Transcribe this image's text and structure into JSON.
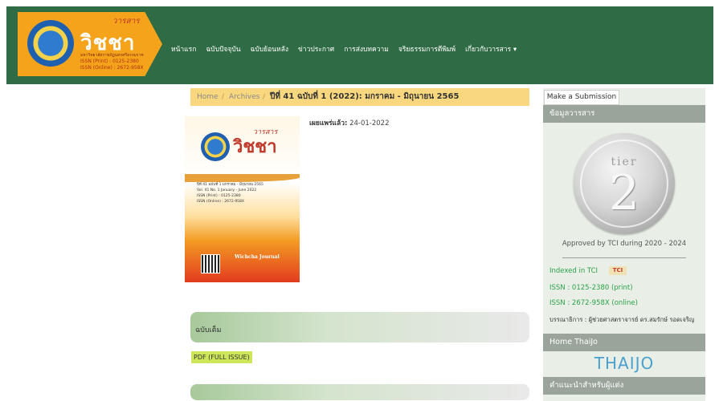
{
  "header": {
    "logo_top": "วารสาร",
    "logo_word": "วิชชา",
    "logo_sub": "มหาวิทยาลัยราชภัฏนครศรีธรรมราช",
    "logo_issn_print": "ISSN (Print) : 0125-2380",
    "logo_issn_online": "ISSN (Online) : 2672-958X",
    "nav": [
      "หน้าแรก",
      "ฉบับปัจจุบัน",
      "ฉบับย้อนหลัง",
      "ข่าวประกาศ",
      "การส่งบทความ",
      "จริยธรรมการตีพิมพ์",
      "เกี่ยวกับวารสาร ▾"
    ]
  },
  "breadcrumb": {
    "home": "Home",
    "sep": "/",
    "archives": "Archives",
    "current": "ปีที่ 41 ฉบับที่ 1 (2022): มกราคม - มิถุนายน 2565"
  },
  "issue": {
    "published_label": "เผยแพร่แล้ว:",
    "published_date": "24-01-2022",
    "cover_top": "วารสาร",
    "cover_word": "วิชชา",
    "cover_line1": "ปีที่ 41 ฉบับที่ 1 มกราคม - มิถุนายน 2565",
    "cover_line2": "Vol. 41 No. 1 January - June 2022",
    "cover_line3": "ISSN (Print) : 0125-2380",
    "cover_line4": "ISSN (Online) : 2672-958X",
    "cover_footer": "Wichcha Journal"
  },
  "fulltext": {
    "label": "ฉบับเต็ม",
    "pdf_button": "PDF (FULL ISSUE)"
  },
  "sidebar": {
    "submit": "Make a Submission",
    "info_title": "ข้อมูลวารสาร",
    "coin_tier": "tier",
    "coin_number": "2",
    "approved": "Approved by TCI during 2020 - 2024",
    "indexed": "Indexed in TCI",
    "tci_logo": "TCI",
    "issn_print": "ISSN : 0125-2380 (print)",
    "issn_online": "ISSN : 2672-958X (online)",
    "editor": "บรรณาธิการ : ผู้ช่วยศาสตราจารย์ ดร.สมรักษ์ รอดเจริญ",
    "home_thaijo": "Home ThaiJo",
    "thaijo_logo": "THAIJO",
    "author_guide": "คำแนะนำสำหรับผู้แต่ง"
  }
}
